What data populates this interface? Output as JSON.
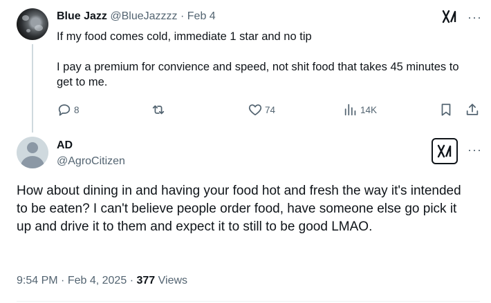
{
  "parent_post": {
    "display_name": "Blue Jazz",
    "handle": "@BlueJazzzz",
    "separator": "·",
    "date": "Feb 4",
    "text_line1": "If my food comes cold, immediate 1 star and no tip",
    "text_line2": "I pay a premium for convience and speed, not shit food that takes 45 minutes to get to me.",
    "actions": {
      "replies": "8",
      "likes": "74",
      "views": "14K"
    }
  },
  "reply_post": {
    "display_name": "AD",
    "handle": "@AgroCitizen",
    "text": "How about dining in and having your food hot and fresh the way it's intended to be eaten? I can't believe people order food, have someone else go pick it up and drive it to them and expect it to still to be good LMAO.",
    "time": "9:54 PM",
    "separator": "·",
    "date": "Feb 4, 2025",
    "views_count": "377",
    "views_label": "Views"
  },
  "icons": {
    "more": "more-horizontal-icon",
    "grok": "grok-icon",
    "reply": "reply-bubble-icon",
    "repost": "repost-icon",
    "like": "heart-icon",
    "views": "analytics-bars-icon",
    "bookmark": "bookmark-icon",
    "share": "share-icon"
  },
  "colors": {
    "text": "#0f1419",
    "muted": "#536471",
    "divider": "#cfd9de"
  }
}
